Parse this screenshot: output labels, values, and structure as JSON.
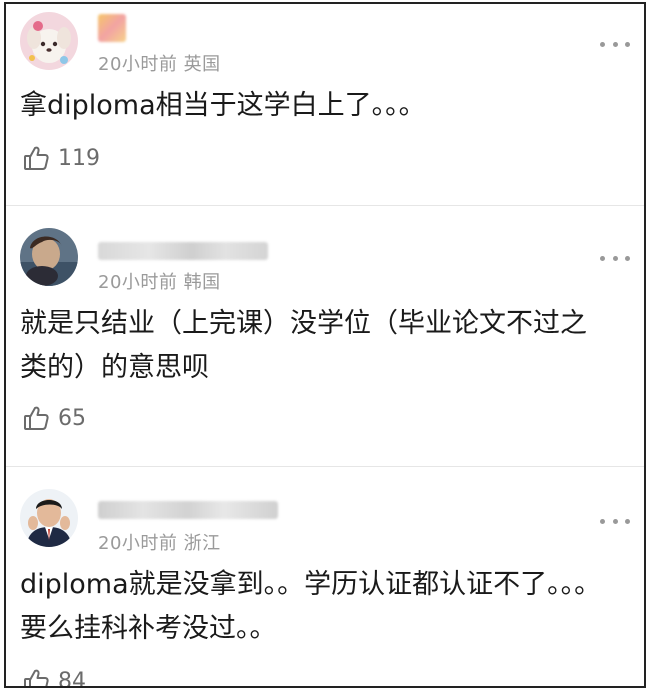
{
  "comments": [
    {
      "time_location": "20小时前 英国",
      "text": "拿diploma相当于这学白上了。。。",
      "likes": "119",
      "avatar_icon": "puppy-avatar",
      "more_icon": "more-dots-icon",
      "like_icon": "thumbs-up-icon"
    },
    {
      "time_location": "20小时前 韩国",
      "text": "就是只结业（上完课）没学位（毕业论文不过之\n类的）的意思呗",
      "likes": "65",
      "avatar_icon": "portrait-avatar",
      "more_icon": "more-dots-icon",
      "like_icon": "thumbs-up-icon"
    },
    {
      "time_location": "20小时前 浙江",
      "text": "diploma就是没拿到。。学历认证都认证不了。。。\n要么挂科补考没过。。",
      "likes": "84",
      "avatar_icon": "man-in-suit-avatar",
      "more_icon": "more-dots-icon",
      "like_icon": "thumbs-up-icon"
    }
  ],
  "colors": {
    "text": "#1a1a1a",
    "meta": "#9a9a9a",
    "divider": "#e6e6e6",
    "frame_border": "#222222"
  }
}
